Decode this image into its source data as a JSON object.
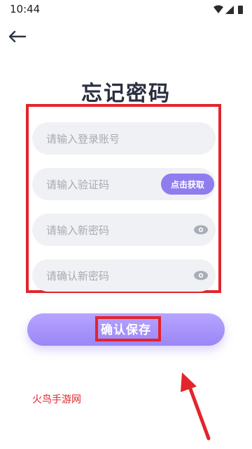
{
  "status_bar": {
    "time": "10:44"
  },
  "title": "忘记密码",
  "fields": {
    "account_placeholder": "请输入登录账号",
    "code_placeholder": "请输入验证码",
    "get_code_label": "点击获取",
    "new_password_placeholder": "请输入新密码",
    "confirm_password_placeholder": "请确认新密码"
  },
  "save_button_label": "确认保存",
  "watermark_text": "火鸟手游网",
  "colors": {
    "accent": "#8f7df0",
    "annotation": "#e3242b",
    "title": "#2a2f3f",
    "field_bg": "#f0f1f4"
  }
}
